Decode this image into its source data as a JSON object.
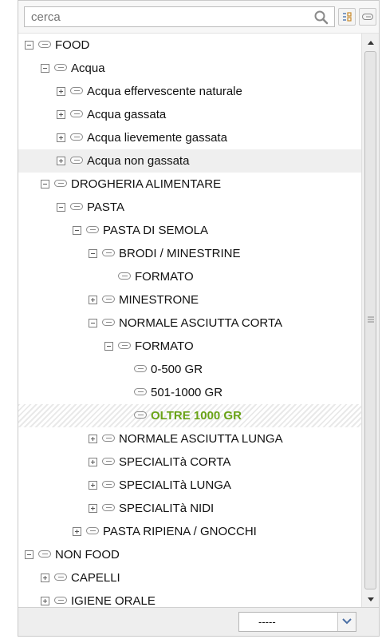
{
  "search": {
    "placeholder": "cerca",
    "value": ""
  },
  "tree": [
    {
      "label": "FOOD",
      "toggle": "minus"
    },
    {
      "label": "Acqua",
      "toggle": "minus"
    },
    {
      "label": "Acqua effervescente naturale",
      "toggle": "plus"
    },
    {
      "label": "Acqua gassata",
      "toggle": "plus"
    },
    {
      "label": "Acqua lievemente gassata",
      "toggle": "plus"
    },
    {
      "label": "Acqua non gassata",
      "toggle": "plus"
    },
    {
      "label": "DROGHERIA ALIMENTARE",
      "toggle": "minus"
    },
    {
      "label": "PASTA",
      "toggle": "minus"
    },
    {
      "label": "PASTA DI SEMOLA",
      "toggle": "minus"
    },
    {
      "label": "BRODI / MINESTRINE",
      "toggle": "minus"
    },
    {
      "label": "FORMATO",
      "toggle": "none"
    },
    {
      "label": "MINESTRONE",
      "toggle": "plus"
    },
    {
      "label": "NORMALE ASCIUTTA CORTA",
      "toggle": "minus"
    },
    {
      "label": "FORMATO",
      "toggle": "minus"
    },
    {
      "label": "0-500 GR",
      "toggle": "none"
    },
    {
      "label": "501-1000 GR",
      "toggle": "none"
    },
    {
      "label": "OLTRE 1000 GR",
      "toggle": "none",
      "selected": true
    },
    {
      "label": "NORMALE ASCIUTTA LUNGA",
      "toggle": "plus"
    },
    {
      "label": "SPECIALITà CORTA",
      "toggle": "plus"
    },
    {
      "label": "SPECIALITà LUNGA",
      "toggle": "plus"
    },
    {
      "label": "SPECIALITà NIDI",
      "toggle": "plus"
    },
    {
      "label": "PASTA RIPIENA / GNOCCHI",
      "toggle": "plus"
    },
    {
      "label": "NON FOOD",
      "toggle": "minus"
    },
    {
      "label": "CAPELLI",
      "toggle": "plus"
    },
    {
      "label": "IGIENE ORALE",
      "toggle": "plus"
    }
  ],
  "footer": {
    "select_value": "-----"
  },
  "icons": {
    "search": "magnifier-icon",
    "toolbar_1": "expand-all-icon",
    "toolbar_2": "tag-icon",
    "node": "tag-icon",
    "dropdown": "chevron-down-icon"
  },
  "colors": {
    "selected_text": "#6aa317"
  }
}
